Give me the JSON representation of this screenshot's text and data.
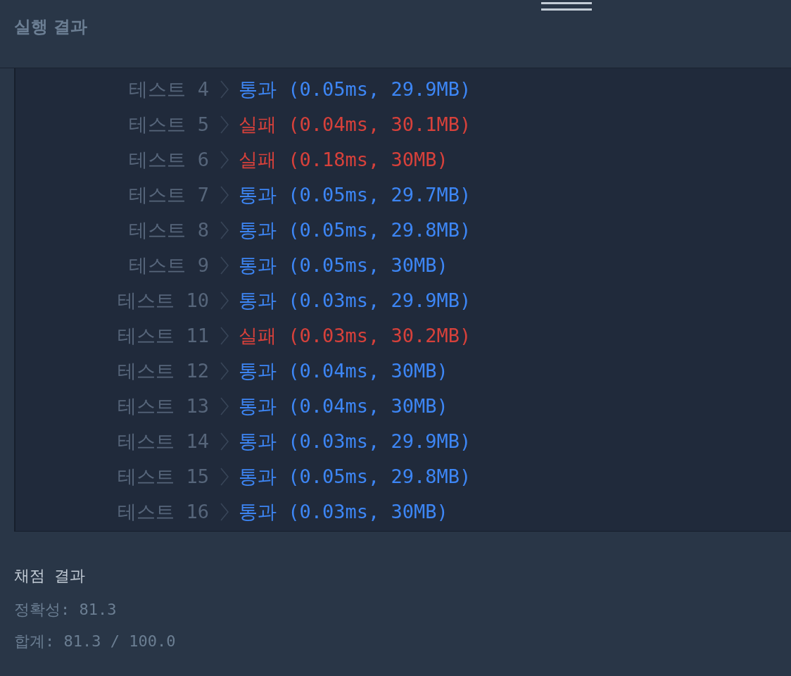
{
  "header": {
    "title": "실행 결과"
  },
  "tests": [
    {
      "label": "테스트 4",
      "kind": "pass",
      "result": "통과 (0.05ms, 29.9MB)"
    },
    {
      "label": "테스트 5",
      "kind": "fail",
      "result": "실패 (0.04ms, 30.1MB)"
    },
    {
      "label": "테스트 6",
      "kind": "fail",
      "result": "실패 (0.18ms, 30MB)"
    },
    {
      "label": "테스트 7",
      "kind": "pass",
      "result": "통과 (0.05ms, 29.7MB)"
    },
    {
      "label": "테스트 8",
      "kind": "pass",
      "result": "통과 (0.05ms, 29.8MB)"
    },
    {
      "label": "테스트 9",
      "kind": "pass",
      "result": "통과 (0.05ms, 30MB)"
    },
    {
      "label": "테스트 10",
      "kind": "pass",
      "result": "통과 (0.03ms, 29.9MB)"
    },
    {
      "label": "테스트 11",
      "kind": "fail",
      "result": "실패 (0.03ms, 30.2MB)"
    },
    {
      "label": "테스트 12",
      "kind": "pass",
      "result": "통과 (0.04ms, 30MB)"
    },
    {
      "label": "테스트 13",
      "kind": "pass",
      "result": "통과 (0.04ms, 30MB)"
    },
    {
      "label": "테스트 14",
      "kind": "pass",
      "result": "통과 (0.03ms, 29.9MB)"
    },
    {
      "label": "테스트 15",
      "kind": "pass",
      "result": "통과 (0.05ms, 29.8MB)"
    },
    {
      "label": "테스트 16",
      "kind": "pass",
      "result": "통과 (0.03ms, 30MB)"
    }
  ],
  "grading": {
    "title": "채점 결과",
    "lines": [
      "정확성: 81.3",
      "합계: 81.3 / 100.0"
    ]
  }
}
